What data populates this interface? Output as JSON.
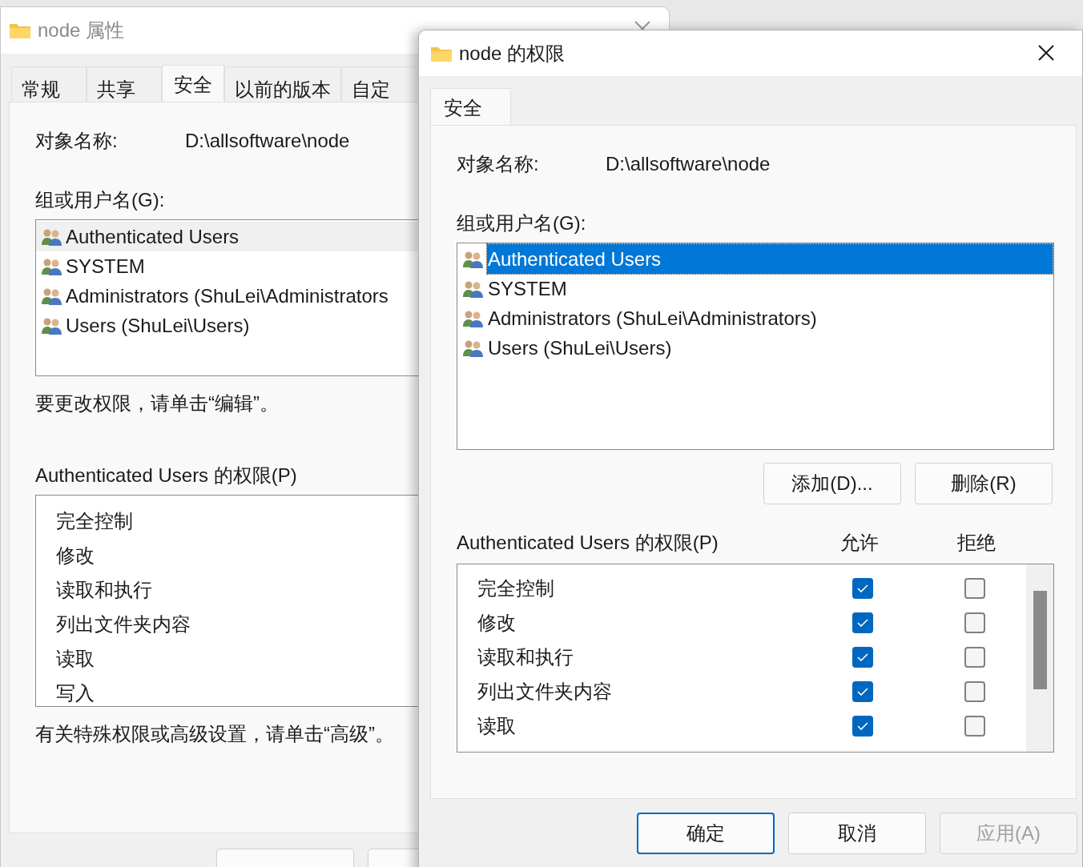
{
  "back_window": {
    "title": "node 属性",
    "tabs": [
      {
        "label": "常规",
        "selected": false
      },
      {
        "label": "共享",
        "selected": false
      },
      {
        "label": "安全",
        "selected": true
      },
      {
        "label": "以前的版本",
        "selected": false
      },
      {
        "label": "自定",
        "selected": false
      }
    ],
    "object_name_label": "对象名称:",
    "object_name": "D:\\allsoftware\\node",
    "groups_label": "组或用户名(G):",
    "groups": [
      {
        "name": "Authenticated Users",
        "selected": true
      },
      {
        "name": "SYSTEM",
        "selected": false
      },
      {
        "name": "Administrators (ShuLei\\Administrators",
        "selected": false
      },
      {
        "name": "Users (ShuLei\\Users)",
        "selected": false
      }
    ],
    "edit_hint": "要更改权限，请单击“编辑”。",
    "permissions_label": "Authenticated Users 的权限(P)",
    "permissions": [
      "完全控制",
      "修改",
      "读取和执行",
      "列出文件夹内容",
      "读取",
      "写入"
    ],
    "advanced_hint": "有关特殊权限或高级设置，请单击“高级”。"
  },
  "front_window": {
    "title": "node 的权限",
    "tabs": [
      {
        "label": "安全",
        "selected": true
      }
    ],
    "object_name_label": "对象名称:",
    "object_name": "D:\\allsoftware\\node",
    "groups_label": "组或用户名(G):",
    "groups": [
      {
        "name": "Authenticated Users",
        "selected": true
      },
      {
        "name": "SYSTEM",
        "selected": false
      },
      {
        "name": "Administrators (ShuLei\\Administrators)",
        "selected": false
      },
      {
        "name": "Users (ShuLei\\Users)",
        "selected": false
      }
    ],
    "group_buttons": [
      "添加(D)...",
      "删除(R)"
    ],
    "permissions_label": "Authenticated Users 的权限(P)",
    "allow_label": "允许",
    "deny_label": "拒绝",
    "permissions": [
      {
        "name": "完全控制",
        "allow": true,
        "deny": false
      },
      {
        "name": "修改",
        "allow": true,
        "deny": false
      },
      {
        "name": "读取和执行",
        "allow": true,
        "deny": false
      },
      {
        "name": "列出文件夹内容",
        "allow": true,
        "deny": false
      },
      {
        "name": "读取",
        "allow": true,
        "deny": false
      }
    ],
    "buttons": [
      {
        "label": "确定",
        "kind": "default",
        "disabled": false
      },
      {
        "label": "取消",
        "kind": "normal",
        "disabled": false
      },
      {
        "label": "应用(A)",
        "kind": "normal",
        "disabled": true
      }
    ]
  }
}
